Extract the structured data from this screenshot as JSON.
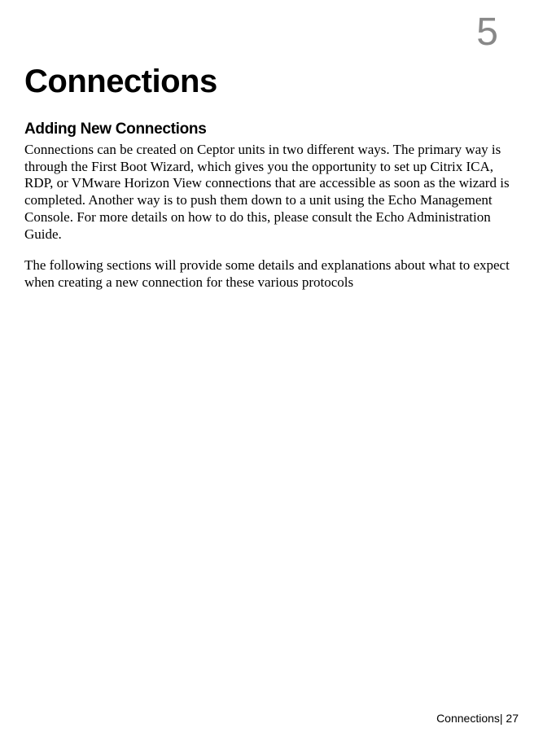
{
  "chapter": {
    "number": "5"
  },
  "title": "Connections",
  "section": {
    "heading": "Adding New Connections",
    "paragraph1": "Connections can be created on Ceptor units in two different ways.  The primary way is through the First Boot Wizard, which gives you the opportunity to set up Citrix ICA, RDP, or VMware Horizon View connections that are accessible as soon as the wizard is completed.  Another way is to push them down to a unit using the Echo Management Console.  For more details on how to do this, please consult the Echo Administration Guide.",
    "paragraph2": "The following sections will provide some details and explanations about what to expect when creating a new connection for these various protocols"
  },
  "footer": {
    "text": "Connections| 27"
  }
}
